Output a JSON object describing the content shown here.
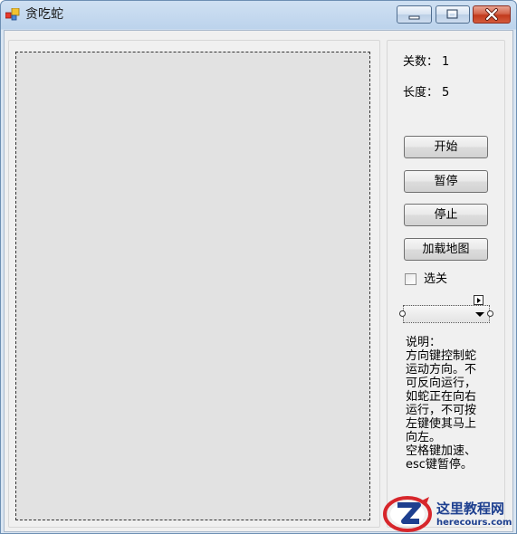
{
  "window": {
    "title": "贪吃蛇",
    "icon": "app-icon"
  },
  "titlebar_buttons": [
    "minimize-icon",
    "maximize-icon",
    "close-icon"
  ],
  "stats": {
    "level_label": "关数：",
    "level_value": "1",
    "length_label": "长度：",
    "length_value": "5"
  },
  "buttons": {
    "start": "开始",
    "pause": "暂停",
    "stop": "停止",
    "load_map": "加载地图"
  },
  "level_select": {
    "checkbox_label": "选关",
    "checked": false,
    "combo_value": ""
  },
  "instructions": {
    "lines": [
      "说明：",
      "方向键控制蛇",
      "运动方向。不",
      "可反向运行，",
      "如蛇正在向右",
      "运行，不可按",
      "左键使其马上",
      "向左。",
      "空格键加速、",
      "esc键暂停。"
    ]
  },
  "watermark": {
    "name": "这里教程网",
    "url": "herecours.com"
  },
  "colors": {
    "board_bg": "#e2e2e2",
    "panel_bg": "#f0f0f0",
    "watermark_blue": "#1d3f8f",
    "watermark_red": "#d7262b"
  }
}
